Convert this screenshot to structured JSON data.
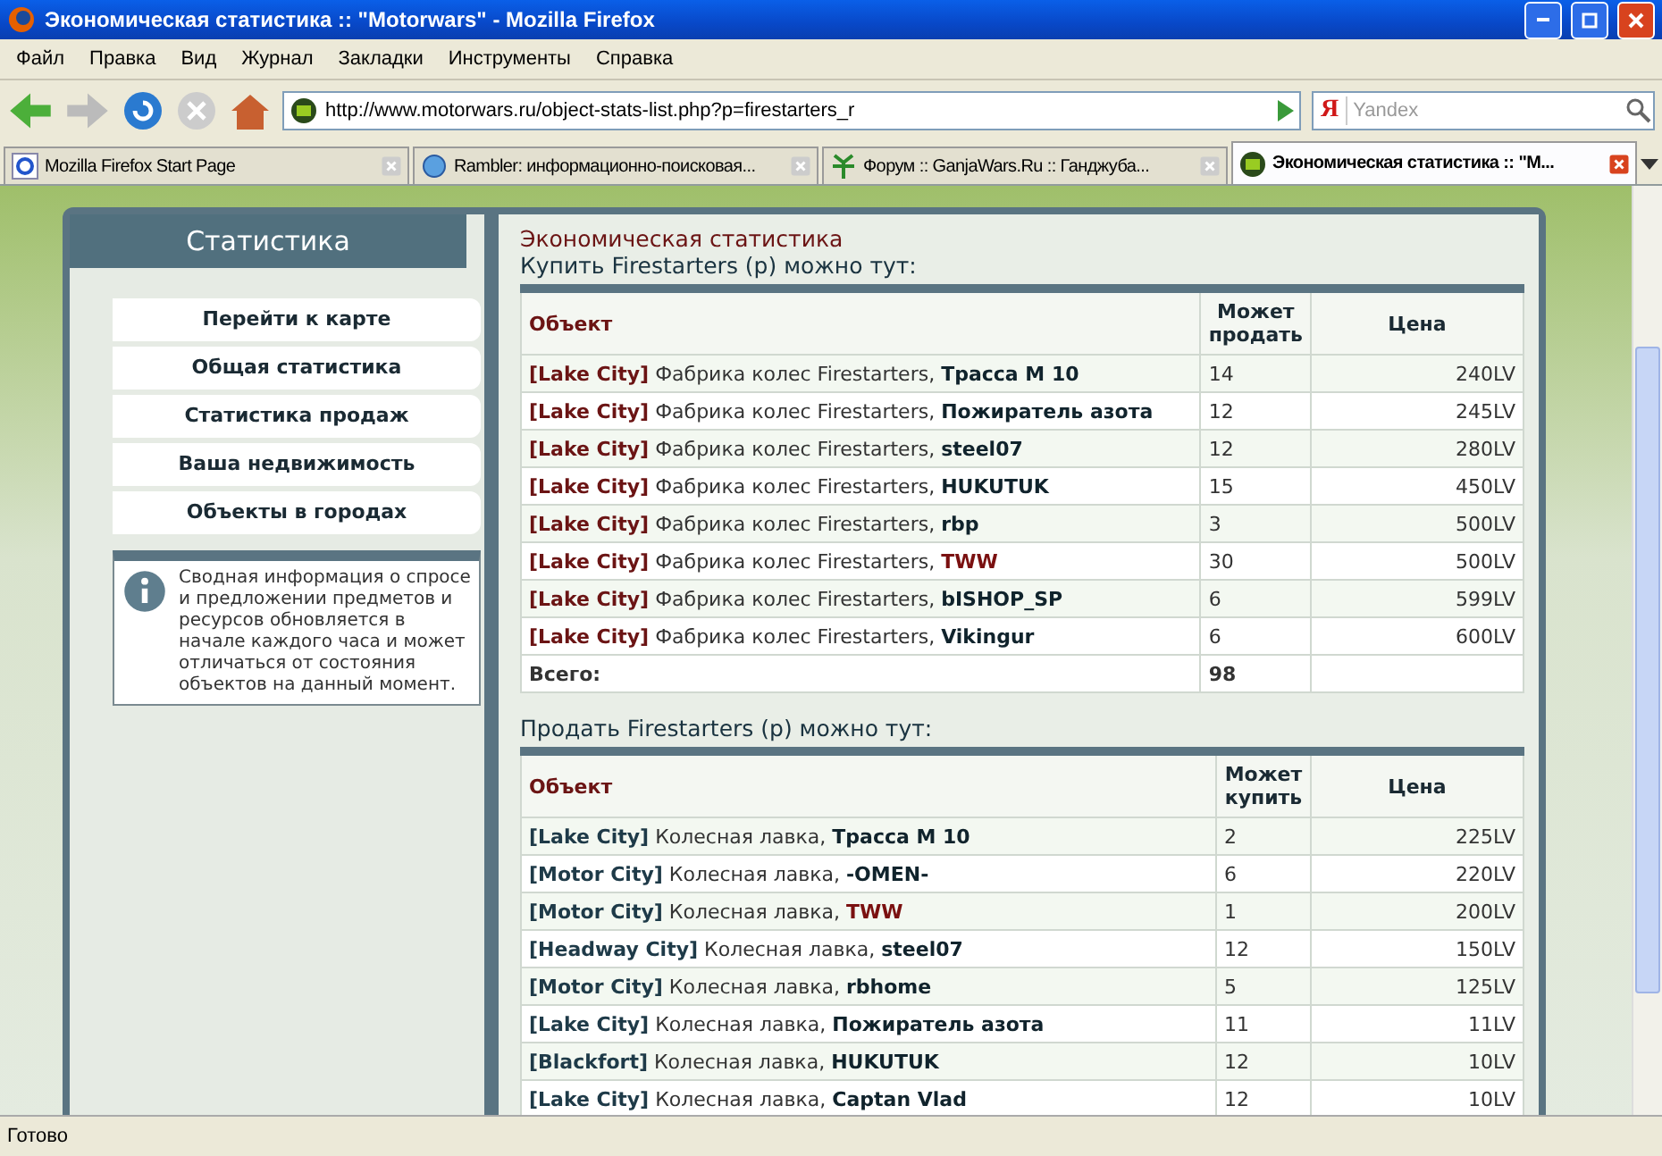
{
  "window": {
    "title": "Экономическая статистика :: \"Motorwars\" - Mozilla Firefox"
  },
  "menu": [
    "Файл",
    "Правка",
    "Вид",
    "Журнал",
    "Закладки",
    "Инструменты",
    "Справка"
  ],
  "toolbar": {
    "url": "http://www.motorwars.ru/object-stats-list.php?p=firestarters_r",
    "search_logo": "Я",
    "search_placeholder": "Yandex"
  },
  "tabs": [
    {
      "label": "Mozilla Firefox Start Page",
      "selected": false
    },
    {
      "label": "Rambler: информационно-поисковая...",
      "selected": false
    },
    {
      "label": "Форум :: GanjaWars.Ru :: Ганджуба...",
      "selected": false
    },
    {
      "label": "Экономическая статистика :: \"M...",
      "selected": true
    }
  ],
  "sidebar": {
    "title": "Статистика",
    "items": [
      "Перейти к карте",
      "Общая статистика",
      "Статистика продаж",
      "Ваша недвижимость",
      "Объекты в городах"
    ],
    "info": "Сводная информация о спросе и предложении предметов и ресурсов обновляется в начале каждого часа и может отличаться от состояния объектов на данный момент."
  },
  "main": {
    "heading": "Экономическая статистика",
    "sections": [
      {
        "title": "Купить Firestarters (р) можно тут:",
        "columns": [
          "Объект",
          "Может продать",
          "Цена"
        ],
        "kind": "buy",
        "rows": [
          {
            "city": "[Lake City]",
            "place": "Фабрика колес Firestarters,",
            "owner": "Трасса М 10",
            "owner_marked": false,
            "count": "14",
            "price": "240LV"
          },
          {
            "city": "[Lake City]",
            "place": "Фабрика колес Firestarters,",
            "owner": "Пожиратель азота",
            "owner_marked": false,
            "count": "12",
            "price": "245LV"
          },
          {
            "city": "[Lake City]",
            "place": "Фабрика колес Firestarters,",
            "owner": "steel07",
            "owner_marked": false,
            "count": "12",
            "price": "280LV"
          },
          {
            "city": "[Lake City]",
            "place": "Фабрика колес Firestarters,",
            "owner": "HUKUTUK",
            "owner_marked": false,
            "count": "15",
            "price": "450LV"
          },
          {
            "city": "[Lake City]",
            "place": "Фабрика колес Firestarters,",
            "owner": "rbp",
            "owner_marked": false,
            "count": "3",
            "price": "500LV"
          },
          {
            "city": "[Lake City]",
            "place": "Фабрика колес Firestarters,",
            "owner": "TWW",
            "owner_marked": true,
            "count": "30",
            "price": "500LV"
          },
          {
            "city": "[Lake City]",
            "place": "Фабрика колес Firestarters,",
            "owner": "bISHOP_SP",
            "owner_marked": false,
            "count": "6",
            "price": "599LV"
          },
          {
            "city": "[Lake City]",
            "place": "Фабрика колес Firestarters,",
            "owner": "Vikingur",
            "owner_marked": false,
            "count": "6",
            "price": "600LV"
          }
        ],
        "total_label": "Всего:",
        "total": "98"
      },
      {
        "title": "Продать Firestarters (р) можно тут:",
        "columns": [
          "Объект",
          "Может купить",
          "Цена"
        ],
        "kind": "sell",
        "rows": [
          {
            "city": "[Lake City]",
            "place": "Колесная лавка,",
            "owner": "Трасса М 10",
            "owner_marked": false,
            "count": "2",
            "price": "225LV"
          },
          {
            "city": "[Motor City]",
            "place": "Колесная лавка,",
            "owner": "-OMEN-",
            "owner_marked": false,
            "count": "6",
            "price": "220LV"
          },
          {
            "city": "[Motor City]",
            "place": "Колесная лавка,",
            "owner": "TWW",
            "owner_marked": true,
            "count": "1",
            "price": "200LV"
          },
          {
            "city": "[Headway City]",
            "place": "Колесная лавка,",
            "owner": "steel07",
            "owner_marked": false,
            "count": "12",
            "price": "150LV"
          },
          {
            "city": "[Motor City]",
            "place": "Колесная лавка,",
            "owner": "rbhome",
            "owner_marked": false,
            "count": "5",
            "price": "125LV"
          },
          {
            "city": "[Lake City]",
            "place": "Колесная лавка,",
            "owner": "Пожиратель азота",
            "owner_marked": false,
            "count": "11",
            "price": "11LV"
          },
          {
            "city": "[Blackfort]",
            "place": "Колесная лавка,",
            "owner": "HUKUTUK",
            "owner_marked": false,
            "count": "12",
            "price": "10LV"
          },
          {
            "city": "[Lake City]",
            "place": "Колесная лавка,",
            "owner": "Captan Vlad",
            "owner_marked": false,
            "count": "12",
            "price": "10LV"
          }
        ]
      }
    ]
  },
  "status_bar": "Готово"
}
